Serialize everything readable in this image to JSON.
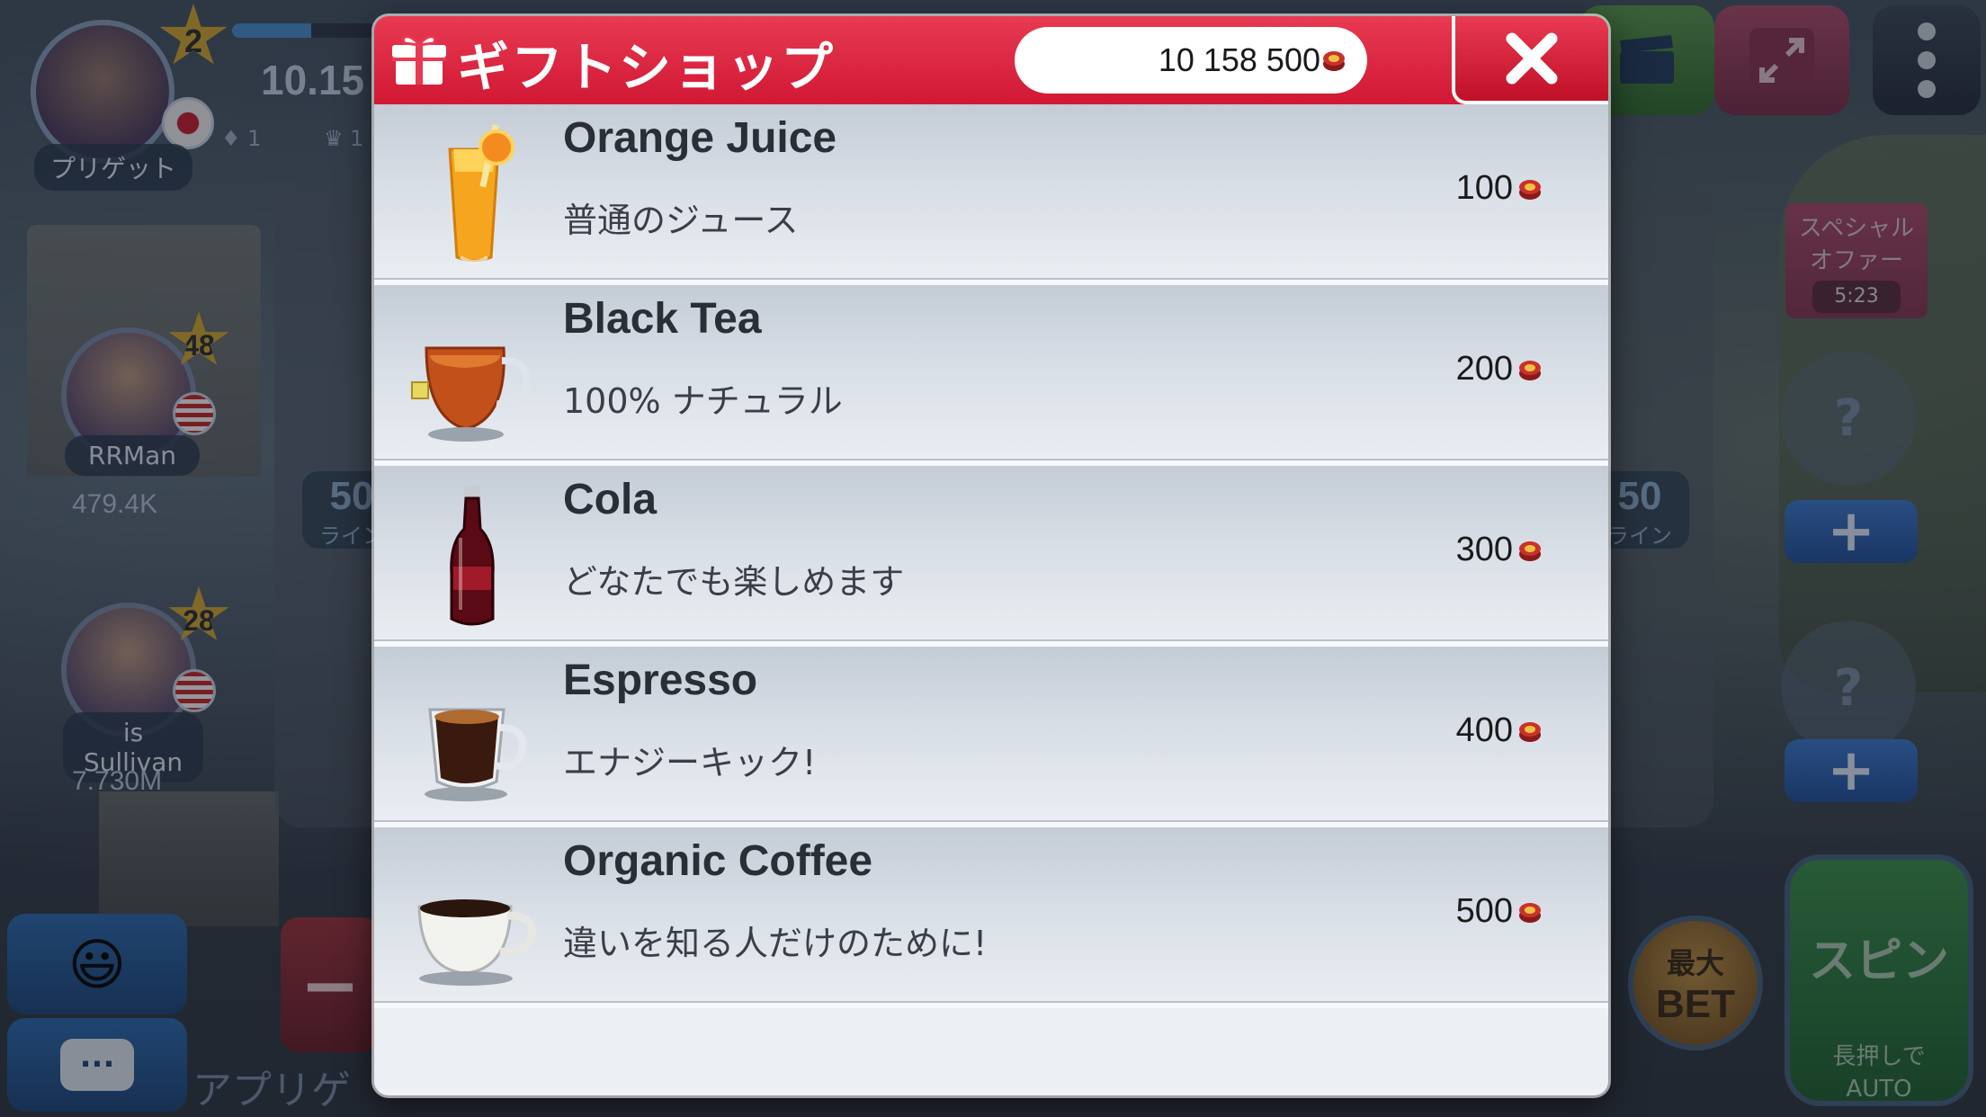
{
  "background": {
    "player": {
      "level": "2",
      "name": "プリゲット",
      "coins": "10.15",
      "gems": "1",
      "crowns": "1",
      "xp_fraction": 0.55
    },
    "friends": [
      {
        "name": "RRMan",
        "level": "48",
        "coins": "479.4K"
      },
      {
        "name": "is Sullivan",
        "level": "28",
        "coins": "7.730M"
      }
    ],
    "lines_left": {
      "number": "50",
      "label": "ライン"
    },
    "lines_right": {
      "number": "50",
      "label": "ライン"
    },
    "special_offer": {
      "label_line1": "スペシャル",
      "label_line2": "オファー",
      "timer": "5:23"
    },
    "empty_seat_symbol": "?",
    "plus_symbol": "+",
    "minus_symbol": "−",
    "chat_symbol": "...",
    "emoji_symbol": "😃",
    "bottom_text": "アプリゲ",
    "max_bet": {
      "line1": "最大",
      "line2": "BET"
    },
    "spin": {
      "label": "スピン",
      "hint_line1": "長押しで",
      "hint_line2": "AUTO"
    }
  },
  "gift_shop": {
    "title": "ギフトショップ",
    "balance": "10 158 500",
    "icons": {
      "title": "gift-box-icon",
      "close": "close-icon",
      "currency": "chip-coin-icon"
    },
    "colors": {
      "header": "#d11834",
      "accent": "#e83a52"
    },
    "items": [
      {
        "name": "Orange Juice",
        "description": "普通のジュース",
        "price": "100",
        "icon": "orange-juice-icon"
      },
      {
        "name": "Black Tea",
        "description": "100% ナチュラル",
        "price": "200",
        "icon": "black-tea-icon"
      },
      {
        "name": "Cola",
        "description": "どなたでも楽しめます",
        "price": "300",
        "icon": "cola-bottle-icon"
      },
      {
        "name": "Espresso",
        "description": "エナジーキック!",
        "price": "400",
        "icon": "espresso-icon"
      },
      {
        "name": "Organic Coffee",
        "description": "違いを知る人だけのために!",
        "price": "500",
        "icon": "coffee-cup-icon"
      }
    ]
  }
}
